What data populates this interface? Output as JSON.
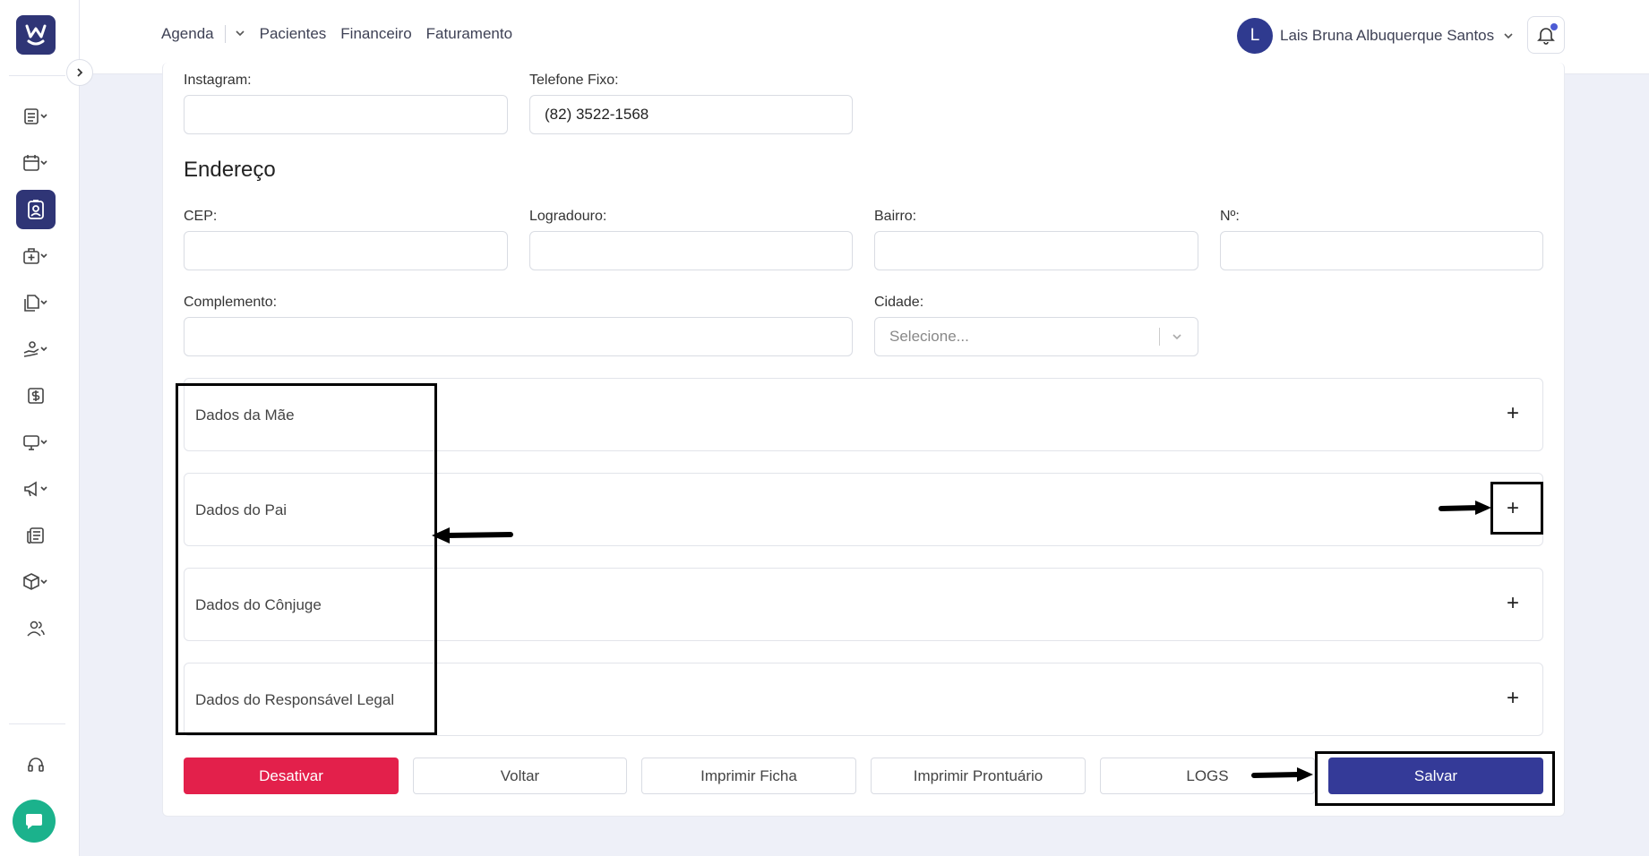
{
  "header": {
    "nav": [
      "Agenda",
      "Pacientes",
      "Financeiro",
      "Faturamento"
    ],
    "user_initial": "L",
    "user_name": "Lais Bruna Albuquerque Santos"
  },
  "sidebar": {
    "items": [
      "list-icon",
      "calendar-icon",
      "patient-card-icon",
      "medical-bag-icon",
      "documents-icon",
      "hand-money-icon",
      "dollar-icon",
      "monitor-icon",
      "megaphone-icon",
      "newspaper-icon",
      "box-icon",
      "users-icon"
    ],
    "active_index": 2
  },
  "form": {
    "instagram": {
      "label": "Instagram:",
      "value": ""
    },
    "telefone_fixo": {
      "label": "Telefone Fixo:",
      "value": "(82) 3522-1568"
    },
    "section_title": "Endereço",
    "cep": {
      "label": "CEP:",
      "value": ""
    },
    "logradouro": {
      "label": "Logradouro:",
      "value": ""
    },
    "bairro": {
      "label": "Bairro:",
      "value": ""
    },
    "numero": {
      "label": "Nº:",
      "value": ""
    },
    "complemento": {
      "label": "Complemento:",
      "value": ""
    },
    "cidade": {
      "label": "Cidade:",
      "placeholder": "Selecione..."
    }
  },
  "accordions": [
    {
      "title": "Dados da Mãe"
    },
    {
      "title": "Dados do Pai"
    },
    {
      "title": "Dados do Cônjuge"
    },
    {
      "title": "Dados do Responsável Legal"
    }
  ],
  "buttons": {
    "desativar": "Desativar",
    "voltar": "Voltar",
    "imprimir_ficha": "Imprimir Ficha",
    "imprimir_prontuario": "Imprimir Prontuário",
    "logs": "LOGS",
    "salvar": "Salvar"
  },
  "colors": {
    "brand": "#2f3576",
    "danger": "#e3204b",
    "primary": "#343a98",
    "chat": "#1bb28c"
  }
}
